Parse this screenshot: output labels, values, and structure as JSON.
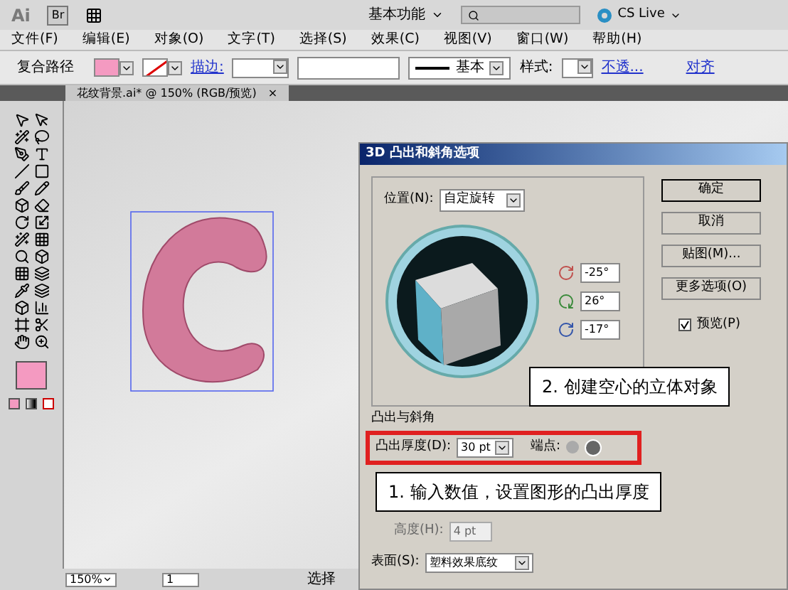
{
  "app_bar": {
    "logo": "Ai",
    "bridge": "Br",
    "workspace": "基本功能",
    "cs_live": "CS Live"
  },
  "menu": [
    "文件(F)",
    "编辑(E)",
    "对象(O)",
    "文字(T)",
    "选择(S)",
    "效果(C)",
    "视图(V)",
    "窗口(W)",
    "帮助(H)"
  ],
  "control_bar": {
    "object_type": "复合路径",
    "stroke_label": "描边:",
    "stroke_style": "基本",
    "style_label": "样式:",
    "opacity_link": "不透...",
    "align_link": "对齐"
  },
  "document_tab": {
    "title": "花纹背景.ai* @ 150% (RGB/预览)",
    "close": "×"
  },
  "dialog": {
    "title": "3D 凸出和斜角选项",
    "position_label": "位置(N):",
    "position_value": "自定旋转",
    "rotations": [
      {
        "kind": "x",
        "value": "-25°"
      },
      {
        "kind": "y",
        "value": "26°"
      },
      {
        "kind": "z",
        "value": "-17°"
      }
    ],
    "buttons": [
      "确定",
      "取消",
      "贴图(M)...",
      "更多选项(O)"
    ],
    "preview": {
      "label": "预览(P)",
      "checked": true
    },
    "extrude_section": "凸出与斜角",
    "depth_label": "凸出厚度(D):",
    "depth_value": "30 pt",
    "cap_label": "端点:",
    "height_label": "高度(H):",
    "height_value": "4 pt",
    "surface_label": "表面(S):",
    "surface_value": "塑料效果底纹"
  },
  "callouts": [
    {
      "text": "2. 创建空心的立体对象"
    },
    {
      "text": "1. 输入数值，设置图形的凸出厚度"
    }
  ],
  "status_bar": {
    "zoom": "150%",
    "page": "1",
    "tool": "选择"
  }
}
